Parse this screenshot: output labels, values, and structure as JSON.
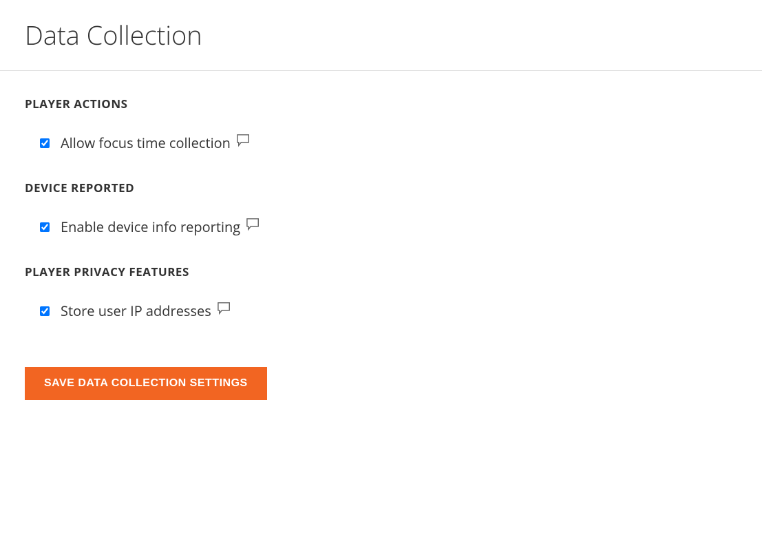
{
  "page": {
    "title": "Data Collection"
  },
  "sections": {
    "player_actions": {
      "heading": "PLAYER ACTIONS",
      "option": {
        "label": "Allow focus time collection",
        "checked": true
      }
    },
    "device_reported": {
      "heading": "DEVICE REPORTED",
      "option": {
        "label": "Enable device info reporting",
        "checked": true
      }
    },
    "player_privacy": {
      "heading": "PLAYER PRIVACY FEATURES",
      "option": {
        "label": "Store user IP addresses",
        "checked": true
      }
    }
  },
  "actions": {
    "save_label": "SAVE DATA COLLECTION SETTINGS"
  }
}
